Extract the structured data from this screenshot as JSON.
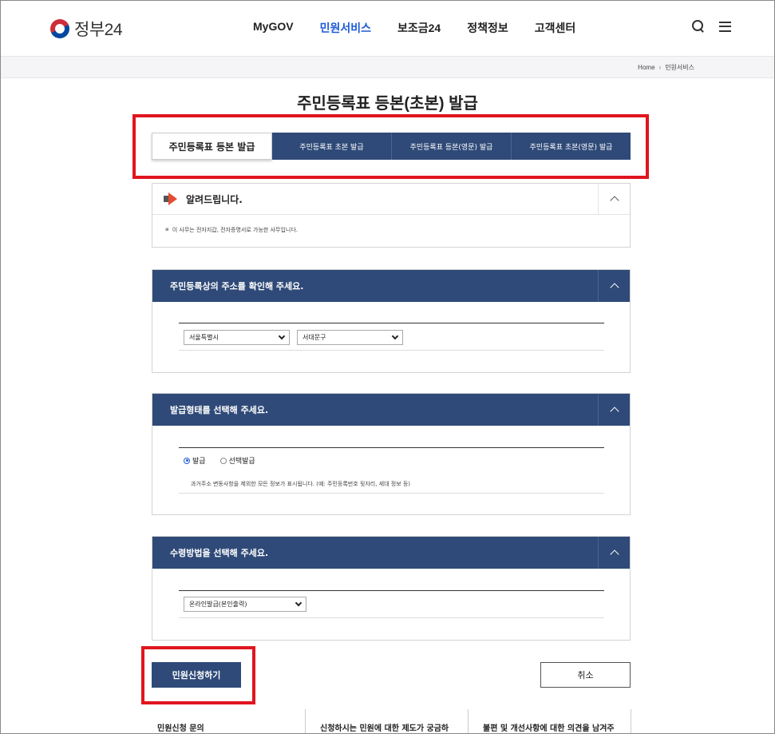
{
  "header": {
    "logo_text": "정부24",
    "nav": [
      "MyGOV",
      "민원서비스",
      "보조금24",
      "정책정보",
      "고객센터"
    ],
    "active_nav_index": 1
  },
  "breadcrumb": {
    "home": "Home",
    "current": "민원서비스"
  },
  "page_title": "주민등록표 등본(초본) 발급",
  "tabs": [
    {
      "label": "주민등록표 등본 발급",
      "active": true
    },
    {
      "label": "주민등록표 초본 발급",
      "active": false
    },
    {
      "label": "주민등록표 등본(영문) 발급",
      "active": false
    },
    {
      "label": "주민등록표 초본(영문) 발급",
      "active": false
    }
  ],
  "notice": {
    "title": "알려드립니다.",
    "body": "이 사무는 전자지갑, 전자증명서로 가능한 사무입니다."
  },
  "address_section": {
    "title": "주민등록상의 주소를 확인해 주세요.",
    "city": "서울특별시",
    "district": "서대문구"
  },
  "issue_type_section": {
    "title": "발급형태를 선택해 주세요.",
    "options": [
      "발급",
      "선택발급"
    ],
    "selected": "발급",
    "description": "과거주소 변동사항을 제외한 모든 정보가 표시됩니다. (예: 주민등록번호 뒷자리, 세대 정보 등)"
  },
  "receive_section": {
    "title": "수령방법을 선택해 주세요.",
    "method": "온라인발급(본인출력)"
  },
  "buttons": {
    "submit": "민원신청하기",
    "cancel": "취소"
  },
  "footer_links": [
    "민원신청 문의",
    "신청하시는 민원에 대한 제도가 궁금하",
    "불편 및 개선사항에 대한 의견을 남겨주"
  ],
  "colors": {
    "primary": "#2f4a78",
    "accent": "#1d5bd6",
    "highlight": "#e0151f"
  }
}
